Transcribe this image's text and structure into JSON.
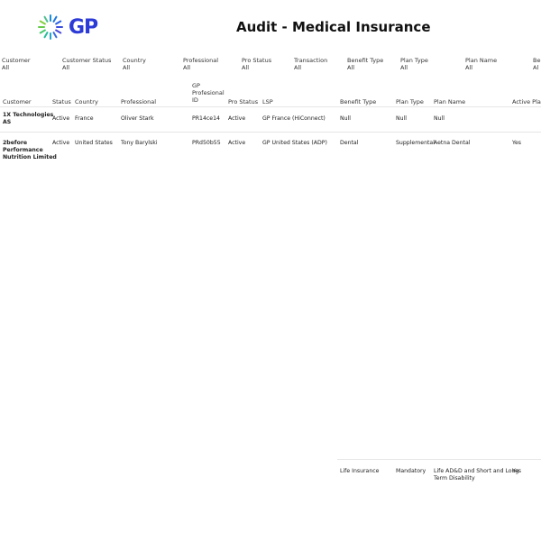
{
  "logo": {
    "text": "GP"
  },
  "title": "Audit - Medical Insurance",
  "filters": [
    {
      "label": "Customer",
      "value": "All"
    },
    {
      "label": "Customer Status",
      "value": "All"
    },
    {
      "label": "Country",
      "value": "All"
    },
    {
      "label": "Professional",
      "value": "All"
    },
    {
      "label": "Pro Status",
      "value": "All"
    },
    {
      "label": "Transaction",
      "value": "All"
    },
    {
      "label": "Benefit Type",
      "value": "All"
    },
    {
      "label": "Plan Type",
      "value": "All"
    },
    {
      "label": "Plan Name",
      "value": "All"
    },
    {
      "label": "Be",
      "value": "Al"
    }
  ],
  "table": {
    "headers": {
      "customer": "Customer",
      "status": "Status",
      "country": "Country",
      "professional": "Professional",
      "gp_id_1": "GP",
      "gp_id_2": "Profesional",
      "gp_id_3": "ID",
      "pro_status": "Pro Status",
      "lsp": "LSP",
      "benefit_type": "Benefit Type",
      "plan_type": "Plan Type",
      "plan_name": "Plan Name",
      "active_plan": "Active Plan"
    },
    "rows": [
      {
        "customer_1": "1X Technologies",
        "customer_2": "AS",
        "status": "Active",
        "country": "France",
        "professional": "Oliver Stark",
        "gp_id": "PR14ce14",
        "pro_status": "Active",
        "lsp": "GP France (HiConnect)",
        "benefit_type": "Null",
        "plan_type": "Null",
        "plan_name": "Null",
        "active_plan": ""
      },
      {
        "customer_1": "2before",
        "customer_2": "Performance",
        "customer_3": "Nutrition Limited",
        "status": "Active",
        "country": "United States",
        "professional": "Tony Barylski",
        "gp_id": "PRd50b55",
        "pro_status": "Active",
        "lsp": "GP United States (ADP)",
        "benefit_type": "Dental",
        "plan_type": "Supplemental",
        "plan_name": "Aetna Dental",
        "active_plan": "Yes"
      }
    ],
    "extra_row": {
      "benefit_type": "Life Insurance",
      "plan_type": "Mandatory",
      "plan_name_1": "Life AD&D and Short and Long",
      "plan_name_2": "Term Disability",
      "active_plan": "Yes"
    }
  }
}
